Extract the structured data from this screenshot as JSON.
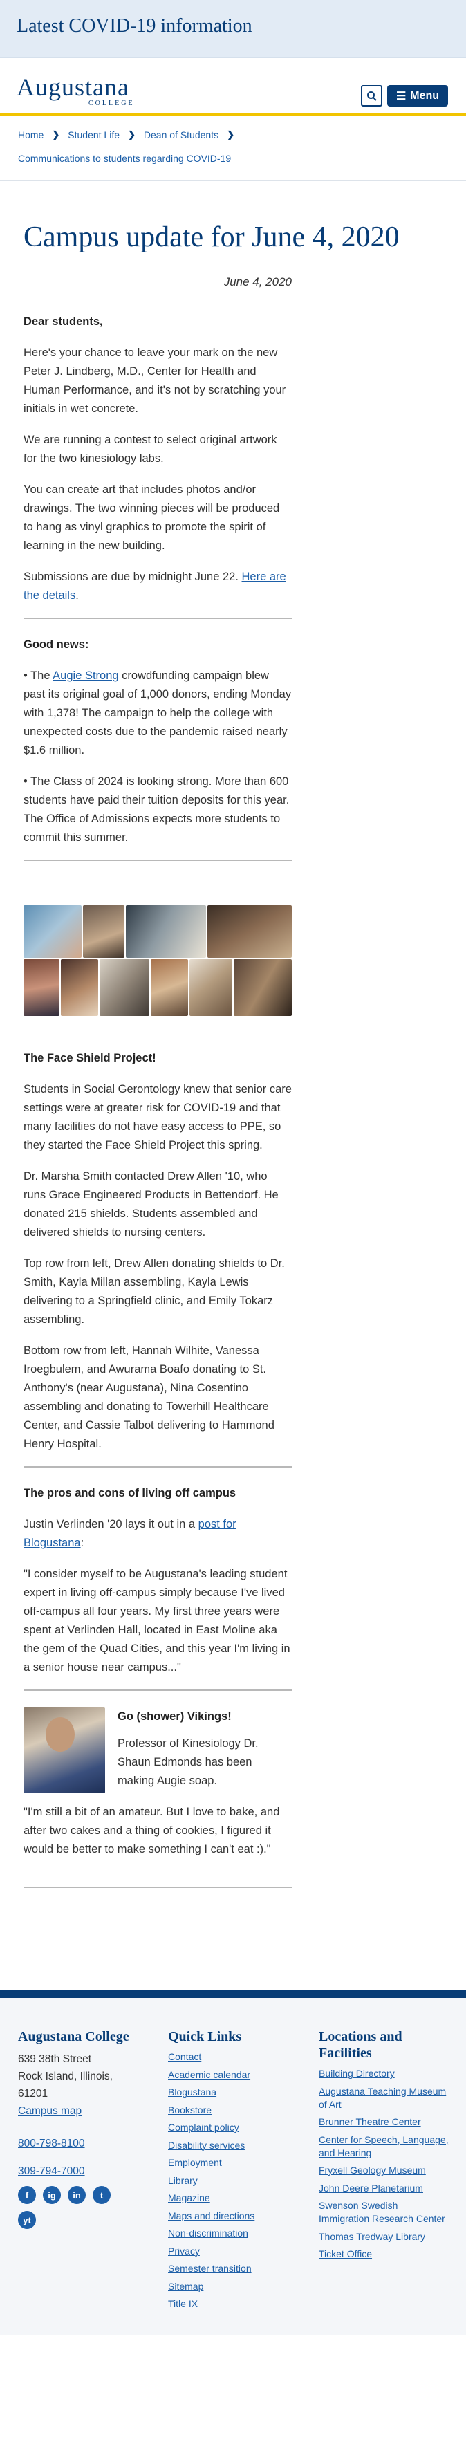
{
  "banner": {
    "text": "Latest COVID-19 information"
  },
  "header": {
    "logo_name": "Augustana",
    "logo_sub": "COLLEGE",
    "menu_label": "Menu"
  },
  "breadcrumb": {
    "items": [
      "Home",
      "Student Life",
      "Dean of Students"
    ],
    "current": "Communications to students regarding COVID-19"
  },
  "article": {
    "title": "Campus update for June 4, 2020",
    "date": "June 4, 2020",
    "greeting": "Dear students,",
    "p1": "Here's your chance to leave your mark on the new Peter J. Lindberg, M.D., Center for Health and Human Performance, and it's not by scratching your initials in wet concrete.",
    "p2": "We are running a contest to select original artwork for the two kinesiology labs.",
    "p3": "You can create art that includes photos and/or drawings. The two winning pieces will be produced to hang as vinyl graphics to promote the spirit of learning in the new building.",
    "p4_pre": "Submissions are due by midnight June 22. ",
    "p4_link": "Here are the details",
    "p4_post": ".",
    "good_news": "Good news:",
    "gn1_pre": "• The ",
    "gn1_link": "Augie Strong",
    "gn1_post": " crowdfunding campaign blew past its original goal of 1,000 donors, ending Monday with 1,378! The campaign to help the college with unexpected costs due to the pandemic raised nearly $1.6 million.",
    "gn2": "• The Class of 2024 is looking strong. More than 600 students have paid their tuition deposits for this year. The Office of Admissions expects more students to commit this summer.",
    "fs_title": "The Face Shield Project!",
    "fs1": "Students in Social Gerontology knew that senior care settings were at greater risk for COVID-19 and that many facilities do not have easy access to PPE, so they started the Face Shield Project this spring.",
    "fs2": "Dr. Marsha Smith contacted Drew Allen '10, who runs Grace Engineered Products in Bettendorf. He donated 215 shields. Students assembled and delivered shields to nursing centers.",
    "fs3": "Top row from left, Drew Allen donating shields to Dr. Smith, Kayla Millan assembling, Kayla Lewis delivering to a Springfield clinic, and Emily Tokarz assembling.",
    "fs4": "Bottom row from left, Hannah Wilhite, Vanessa Iroegbulem, and Awurama Boafo donating to St. Anthony's (near Augustana), Nina Cosentino assembling and donating to Towerhill Healthcare Center, and Cassie Talbot delivering to Hammond Henry Hospital.",
    "pc_title": "The pros and cons of living off campus",
    "pc1_pre": "Justin Verlinden '20 lays it out in a ",
    "pc1_link": "post for Blogustana",
    "pc1_post": ":",
    "pc_quote": "\"I consider myself to be Augustana's leading student expert in living off-campus simply because I've lived off-campus all four years. My first three years were spent at Verlinden Hall, located in East Moline aka the gem of the Quad Cities, and this year I'm living in a senior house near campus...\"",
    "sh_title": "Go (shower) Vikings!",
    "sh1": "Professor of Kinesiology Dr. Shaun Edmonds has been making Augie soap.",
    "sh2": "\"I'm still a bit of an amateur. But I love to bake, and after two cakes and a thing of cookies, I figured it would be better to make something I can't eat :).\""
  },
  "footer": {
    "col1": {
      "title": "Augustana College",
      "addr1": "639 38th Street",
      "addr2": "Rock Island, Illinois,",
      "addr3": "61201",
      "map": "Campus map",
      "phone1": "800-798-8100",
      "phone2": "309-794-7000"
    },
    "col2": {
      "title": "Quick Links",
      "links": [
        "Contact",
        "Academic calendar",
        "Blogustana",
        "Bookstore",
        "Complaint policy",
        "Disability services",
        "Employment",
        "Library",
        "Magazine",
        "Maps and directions",
        "Non-discrimination",
        "Privacy",
        "Semester transition",
        "Sitemap",
        "Title IX"
      ]
    },
    "col3": {
      "title": "Locations and Facilities",
      "links": [
        "Building Directory",
        "Augustana Teaching Museum of Art",
        "Brunner Theatre Center",
        "Center for Speech, Language, and Hearing",
        "Fryxell Geology Museum",
        "John Deere Planetarium",
        "Swenson Swedish Immigration Research Center",
        "Thomas Tredway Library",
        "Ticket Office"
      ]
    },
    "social": [
      "f",
      "ig",
      "in",
      "t",
      "yt"
    ]
  },
  "colors": {
    "brand": "#083d77",
    "accent": "#f2c400",
    "link": "#1d5fa8"
  }
}
